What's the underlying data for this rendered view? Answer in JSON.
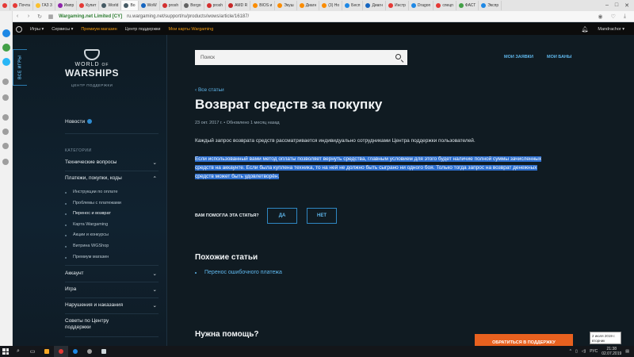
{
  "browser": {
    "tabs": [
      {
        "label": "Почта",
        "color": "#e53935"
      },
      {
        "label": "ГАЗ 3",
        "color": "#fbc02d"
      },
      {
        "label": "Импр",
        "color": "#8e24aa"
      },
      {
        "label": "Купит",
        "color": "#e53935"
      },
      {
        "label": "World",
        "color": "#455a64"
      },
      {
        "label": "Во",
        "color": "#455a64",
        "active": true
      },
      {
        "label": "WoW",
        "color": "#1565c0"
      },
      {
        "label": "prosh",
        "color": "#d32f2f"
      },
      {
        "label": "Borgo",
        "color": "#616161"
      },
      {
        "label": "prosh",
        "color": "#d32f2f"
      },
      {
        "label": "AMD R",
        "color": "#c62828"
      },
      {
        "label": "BIOS и",
        "color": "#fb8c00"
      },
      {
        "label": "Экуш",
        "color": "#fb8c00"
      },
      {
        "label": "Диагн",
        "color": "#fb8c00"
      },
      {
        "label": "(3) Но",
        "color": "#fb8c00"
      },
      {
        "label": "Бесп",
        "color": "#1e88e5"
      },
      {
        "label": "Диагн",
        "color": "#1565c0"
      },
      {
        "label": "Инстр",
        "color": "#e53935"
      },
      {
        "label": "Dragon",
        "color": "#1e88e5"
      },
      {
        "label": "спецп",
        "color": "#e53935"
      },
      {
        "label": "ФАСТ",
        "color": "#43a047"
      },
      {
        "label": "Экспр",
        "color": "#1e88e5"
      }
    ],
    "secure_label": "Wargaming.net Limited [CY]",
    "url": "ru.wargaming.net/support/ru/products/wows/article/16187/"
  },
  "topnav": {
    "games": "Игры ▾",
    "services": "Сервисы ▾",
    "premium_shop": "Премиум магазин",
    "support_center": "Центр поддержки",
    "wg_cards": "Мои карты Wargaming",
    "user": "Mandrachor ▾"
  },
  "sidebar": {
    "vertical_tab": "ВСЕ ИГРЫ",
    "logo_top": "WORLD",
    "logo_of": "OF",
    "logo_main": "WARSHIPS",
    "logo_sub": "ЦЕНТР ПОДДЕРЖКИ",
    "news": "Новости",
    "categories_title": "КАТЕГОРИИ",
    "tech_issues": "Технические вопросы",
    "payments": "Платежи, покупки, коды",
    "payment_items": [
      "Инструкции по оплате",
      "Проблемы с платежами",
      "Перенос и возврат",
      "Карта Wargaming",
      "Акции и конкурсы",
      "Витрина WGShop",
      "Премиум магазин"
    ],
    "account": "Аккаунт",
    "game": "Игра",
    "violations": "Нарушения и наказания",
    "support_tips": "Советы по Центру поддержки"
  },
  "main": {
    "search_placeholder": "Поиск",
    "my_requests": "МОИ ЗАЯВКИ",
    "my_bans": "МОИ БАНЫ",
    "back": "‹ Все статьи",
    "title": "Возврат средств за покупку",
    "date": "23 окт. 2017 г.",
    "updated": "Обновлено 1 месяц назад",
    "para1": "Каждый запрос возврата средств рассматривается индивидуально сотрудниками Центра поддержки пользователей.",
    "para2_line1": "Если использованный вами метод оплаты позволяет вернуть средства, главным условием для этого будет наличие полной суммы зачисленных",
    "para2_line2": "средств на аккаунте. Если была куплена техника, то на ней не должно быть сыграно ни одного боя. Только тогда запрос на возврат денежных",
    "para2_line3": "средств может быть удовлетворён.",
    "helpful": "ВАМ ПОМОГЛА ЭТА СТАТЬЯ?",
    "yes": "ДА",
    "no": "НЕТ",
    "similar_title": "Похожие статьи",
    "similar_link": "Перенос ошибочного платежа",
    "need_help": "Нужна помощь?",
    "support_button": "ОБРАТИТЬСЯ В ПОДДЕРЖКУ"
  },
  "tooltip": {
    "line1": "2 июля 2019 г.",
    "line2": "вторник"
  },
  "taskbar": {
    "lang": "РУС",
    "time": "21:38",
    "date": "02.07.2019"
  }
}
